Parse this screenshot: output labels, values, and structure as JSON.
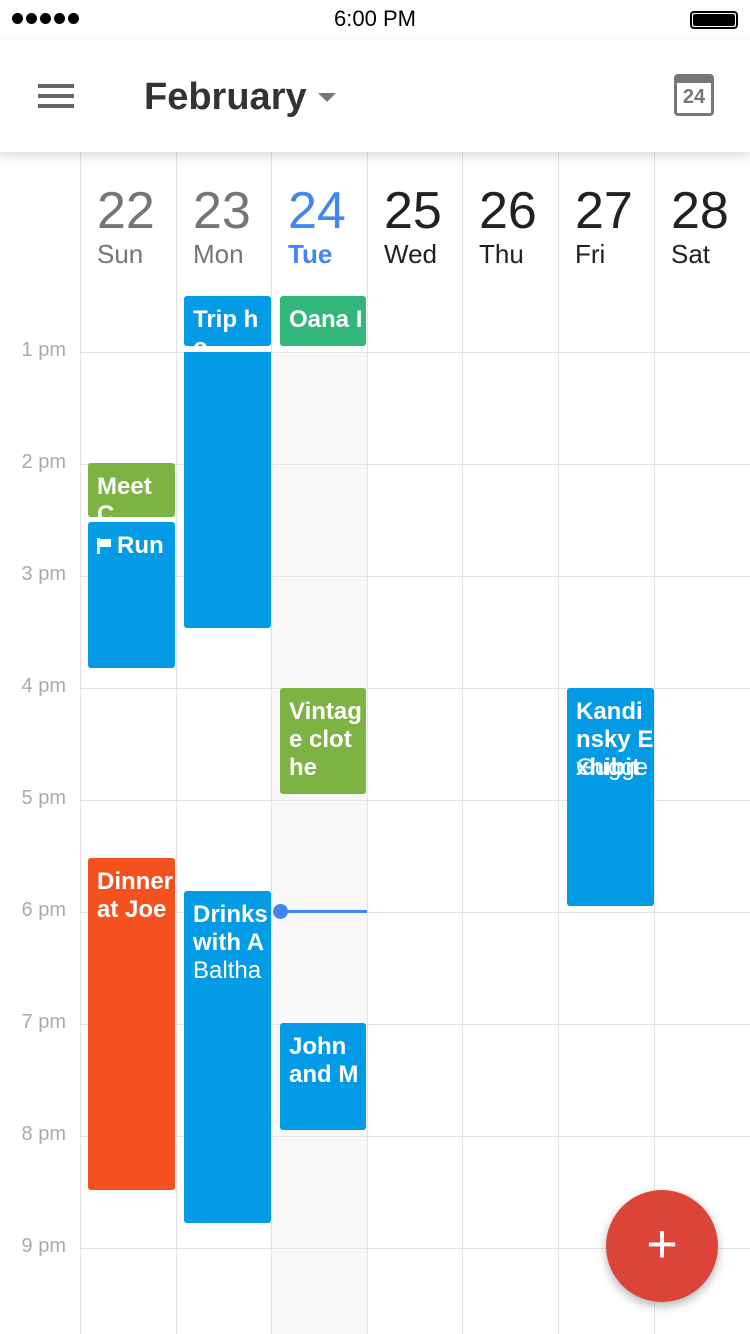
{
  "status": {
    "time": "6:00 PM"
  },
  "header": {
    "title": "February",
    "today_badge": "24"
  },
  "days": [
    {
      "num": "22",
      "name": "Sun"
    },
    {
      "num": "23",
      "name": "Mon"
    },
    {
      "num": "24",
      "name": "Tue"
    },
    {
      "num": "25",
      "name": "Wed"
    },
    {
      "num": "26",
      "name": "Thu"
    },
    {
      "num": "27",
      "name": "Fri"
    },
    {
      "num": "28",
      "name": "Sat"
    }
  ],
  "today_index": 2,
  "hours": [
    "1 pm",
    "2 pm",
    "3 pm",
    "4 pm",
    "5 pm",
    "6 pm",
    "7 pm",
    "8 pm",
    "9 pm"
  ],
  "events": [
    {
      "title": "Trip ho",
      "day": "Mon",
      "color": "#039be5"
    },
    {
      "title": "Oana I",
      "day": "Tue",
      "color": "#33b679"
    },
    {
      "title": "Meet C",
      "day": "Sun",
      "color": "#7cb342"
    },
    {
      "title": "Run",
      "day": "Sun",
      "color": "#039be5",
      "icon": "flag-icon"
    },
    {
      "title": "Vintage clothe",
      "day": "Tue",
      "color": "#7cb342"
    },
    {
      "title": "Kandinsky Exhibit",
      "location": "Gugge",
      "day": "Fri",
      "color": "#039be5"
    },
    {
      "title": "Dinner at Joe",
      "day": "Sun",
      "color": "#f4511e"
    },
    {
      "title": "Drinks with A",
      "location": "Baltha",
      "day": "Mon",
      "color": "#039be5"
    },
    {
      "title": "John and M",
      "day": "Tue",
      "color": "#039be5"
    }
  ],
  "fab": {
    "label": "+"
  },
  "colors": {
    "today": "#4285f4",
    "past": "#757575",
    "future": "#212121"
  }
}
